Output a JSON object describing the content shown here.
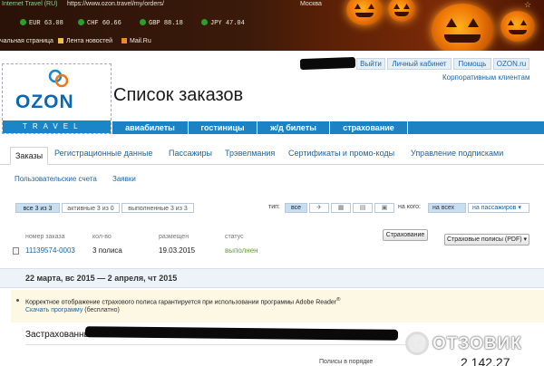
{
  "browser": {
    "site_label": "Internet Travel (RU)",
    "url": "https://www.ozon.travel/my/orders/",
    "city": "Москва",
    "currencies": [
      {
        "code": "EUR",
        "value": "63.08"
      },
      {
        "code": "CHF",
        "value": "60.66"
      },
      {
        "code": "GBP",
        "value": "88.18"
      },
      {
        "code": "JPY",
        "value": "47.04"
      }
    ],
    "bookmarks": [
      "чальная страница",
      "Лента новостей",
      "Mail.Ru"
    ]
  },
  "header": {
    "logo_main": "OZON",
    "logo_sub": "TRAVEL",
    "title": "Список заказов",
    "top_links": [
      "Выйти",
      "Личный кабинет",
      "Помощь",
      "OZON.ru"
    ],
    "corporate_link": "Корпоративным клиентам",
    "nav": [
      "авиабилеты",
      "гостиницы",
      "ж/д билеты",
      "страхование"
    ]
  },
  "tabs": [
    "Заказы",
    "Регистрационные данные",
    "Пассажиры",
    "Трэвелмания",
    "Сертификаты и промо-коды",
    "Управление подписками"
  ],
  "sub_tabs": [
    "Пользовательские счета",
    "Заявки"
  ],
  "filters": {
    "status": [
      {
        "label": "все 3 из 3",
        "active": true
      },
      {
        "label": "активные 3 из 0",
        "active": false
      },
      {
        "label": "выполненные 3 из 3",
        "active": false
      }
    ],
    "type_label": "тип:",
    "type_all": "все",
    "who_label": "на кого:",
    "who_all": "на всех",
    "who_passengers": "на пассажиров"
  },
  "orders": {
    "columns": [
      "номер заказа",
      "кол-во",
      "размещен",
      "статус"
    ],
    "rows": [
      {
        "number": "11139574-0003",
        "qty": "3 полиса",
        "placed": "19.03.2015",
        "status": "выполнен"
      }
    ],
    "btn_policy": "Страхование",
    "btn_pdf": "Страховые полисы (PDF)"
  },
  "trip": {
    "dates": "22 марта, вс 2015 — 2 апреля, чт 2015",
    "notice": "Корректное отображение страхового полиса гарантируется при использовании программы Adobe Reader",
    "notice_reg": "®",
    "download_link": "Скачать программу",
    "download_note": "(бесплатно)",
    "insured_label": "Застрахованные:",
    "bottom_text": "Полисы в порядке",
    "bottom_price": "2 142,27"
  },
  "watermark": {
    "icon": "O",
    "text": "ОТЗОВИК"
  },
  "colors": {
    "brand": "#1c82c4",
    "link": "#1a66a8",
    "done": "#6a9a3a"
  }
}
